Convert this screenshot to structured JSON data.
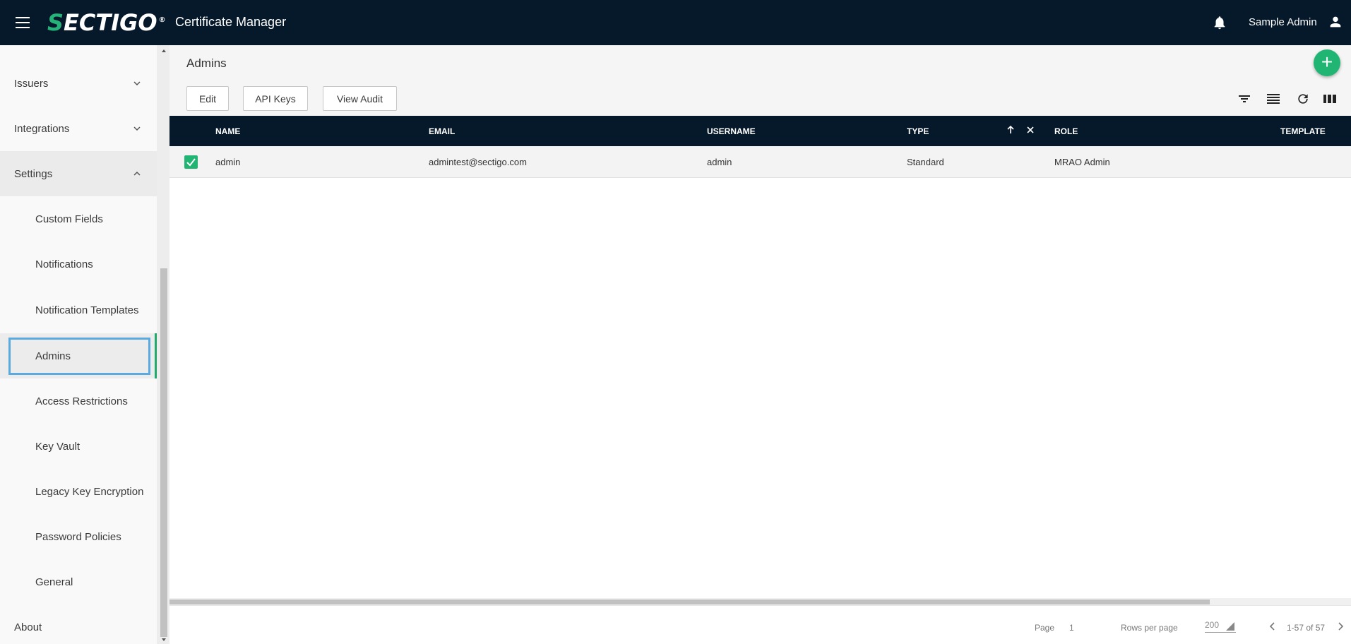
{
  "header": {
    "logo_main": "ECTIGO",
    "logo_s": "S",
    "logo_reg": "®",
    "app_title": "Certificate Manager",
    "user_name": "Sample Admin"
  },
  "sidebar": {
    "items": [
      {
        "label": "Issuers"
      },
      {
        "label": "Integrations"
      },
      {
        "label": "Settings"
      },
      {
        "label": "Custom Fields"
      },
      {
        "label": "Notifications"
      },
      {
        "label": "Notification Templates"
      },
      {
        "label": "Admins"
      },
      {
        "label": "Access Restrictions"
      },
      {
        "label": "Key Vault"
      },
      {
        "label": "Legacy Key Encryption"
      },
      {
        "label": "Password Policies"
      },
      {
        "label": "General"
      },
      {
        "label": "About"
      }
    ],
    "active": "Admins"
  },
  "page": {
    "title": "Admins",
    "fab_label": "+",
    "buttons": {
      "edit": "Edit",
      "api_keys": "API Keys",
      "view_audit": "View Audit"
    }
  },
  "table": {
    "columns": [
      "NAME",
      "EMAIL",
      "USERNAME",
      "TYPE",
      "ROLE",
      "TEMPLATE"
    ],
    "rows": [
      {
        "name": "admin",
        "email": "admintest@sectigo.com",
        "username": "admin",
        "type": "Standard",
        "role": "MRAO Admin",
        "template": "",
        "checked": true
      }
    ]
  },
  "footer": {
    "page_label": "Page",
    "page_value": "1",
    "rows_label": "Rows per page",
    "rows_value": "200",
    "range": "1-57 of 57"
  },
  "colors": {
    "topbar": "#06192b",
    "accent_green": "#21b574",
    "focus_blue": "#5aaae0"
  }
}
